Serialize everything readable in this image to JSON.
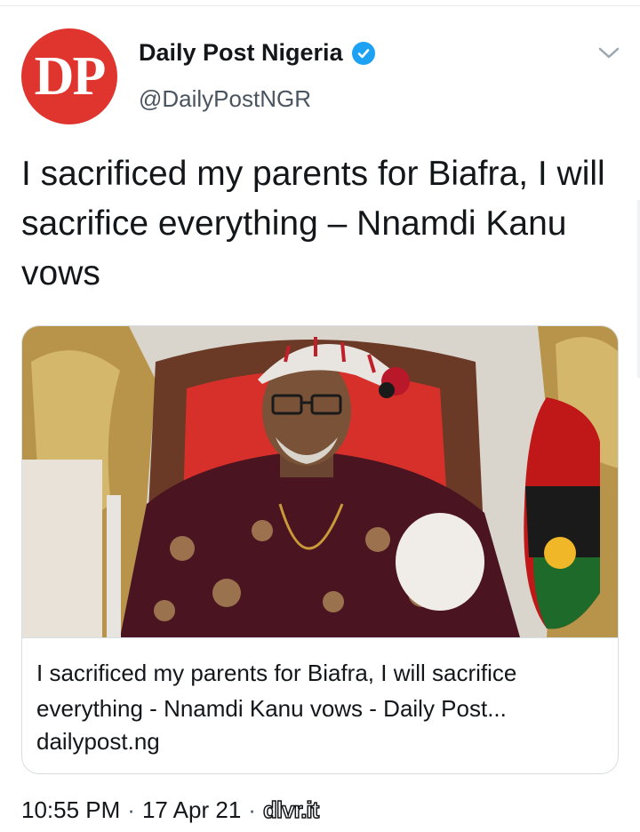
{
  "author": {
    "avatar_text": "DP",
    "display_name": "Daily Post Nigeria",
    "handle": "@DailyPostNGR",
    "verified": true,
    "avatar_color": "#e0352f"
  },
  "tweet": {
    "text": "I sacrificed my parents for Biafra, I will sacrifice everything – Nnamdi Kanu vows"
  },
  "link_card": {
    "title": "I sacrificed my parents for Biafra, I will sacrifice everything - Nnamdi Kanu vows - Daily Post...",
    "domain": "dailypost.ng",
    "image_icon": "photo"
  },
  "meta": {
    "time": "10:55 PM",
    "separator": "·",
    "date": "17 Apr 21",
    "source": "dlvr.it"
  },
  "icons": {
    "verified": "verified-badge-icon",
    "menu": "chevron-down-icon"
  },
  "colors": {
    "accent": "#1da1f2",
    "text": "#14171a",
    "secondary": "#4a5560"
  }
}
